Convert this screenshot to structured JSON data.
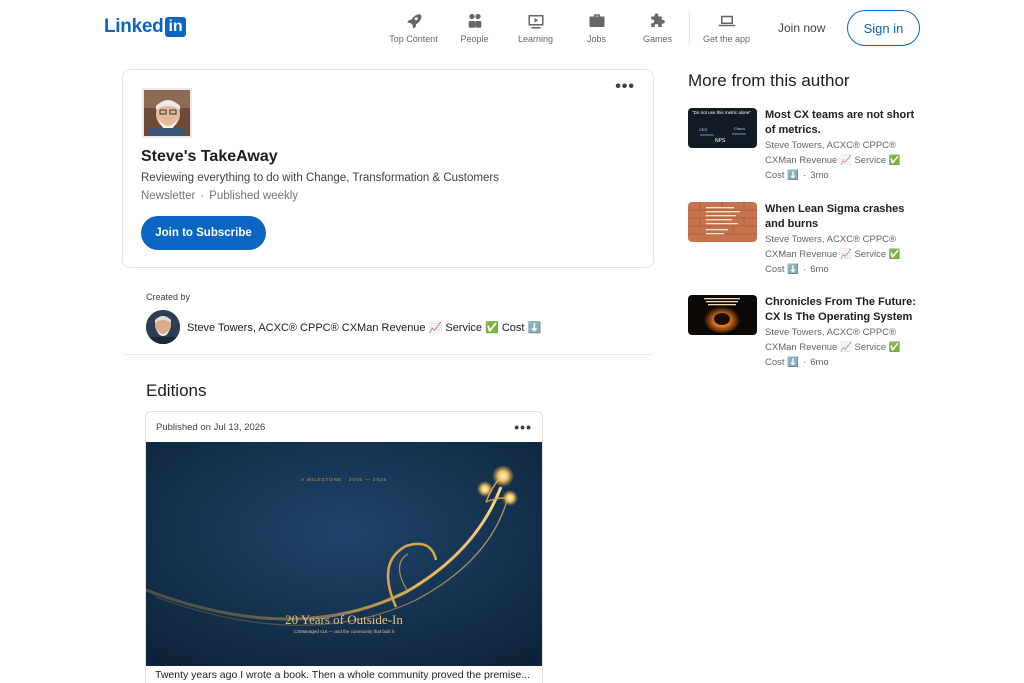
{
  "header": {
    "logo_text": "Linked",
    "logo_box": "in",
    "nav": [
      {
        "label": "Top Content",
        "icon": "rocket-icon"
      },
      {
        "label": "People",
        "icon": "people-icon"
      },
      {
        "label": "Learning",
        "icon": "learning-icon"
      },
      {
        "label": "Jobs",
        "icon": "briefcase-icon"
      },
      {
        "label": "Games",
        "icon": "puzzle-icon"
      },
      {
        "label": "Get the app",
        "icon": "laptop-icon"
      }
    ],
    "join_now": "Join now",
    "sign_in": "Sign in"
  },
  "newsletter": {
    "title": "Steve's TakeAway",
    "description": "Reviewing everything to do with Change, Transformation & Customers",
    "type": "Newsletter",
    "frequency": "Published weekly",
    "subscribe_label": "Join to Subscribe",
    "more": "•••"
  },
  "created_by": {
    "label": "Created by",
    "author": "Steve Towers, ACXC® CPPC® CXMan Revenue 📈 Service ✅ Cost ⬇️"
  },
  "editions": {
    "title": "Editions",
    "items": [
      {
        "date": "Published on Jul 13, 2026",
        "more": "•••",
        "image_small": "A MILESTONE · 2006 — 2026",
        "image_title": "20 Years of Outside-In",
        "image_subtitle": "CXManaged v16 — and the community that built it",
        "caption": "Twenty years ago I wrote a book. Then a whole community proved the premise..."
      }
    ]
  },
  "more_from_author": {
    "title": "More from this author",
    "articles": [
      {
        "title": "Most CX teams are not short of metrics.",
        "author_line1": "Steve Towers, ACXC® CPPC®",
        "author_line2": "CXMan Revenue 📈 Service ✅",
        "cost": "Cost ⬇️",
        "age": "3mo",
        "thumb_text": "\"Do not use this metric alone\"",
        "thumb_labels": [
          "CES",
          "Churn",
          "NPS"
        ]
      },
      {
        "title": "When Lean Sigma crashes and burns",
        "author_line1": "Steve Towers, ACXC® CPPC®",
        "author_line2": "CXMan Revenue 📈 Service ✅",
        "cost": "Cost ⬇️",
        "age": "6mo"
      },
      {
        "title": "Chronicles From The Future: CX Is The Operating System",
        "author_line1": "Steve Towers, ACXC® CPPC®",
        "author_line2": "CXMan Revenue 📈 Service ✅",
        "cost": "Cost ⬇️",
        "age": "6mo"
      }
    ]
  },
  "colors": {
    "brand": "#0a66c2",
    "edition_bg": "#14304f",
    "gold": "#d8a64a"
  }
}
